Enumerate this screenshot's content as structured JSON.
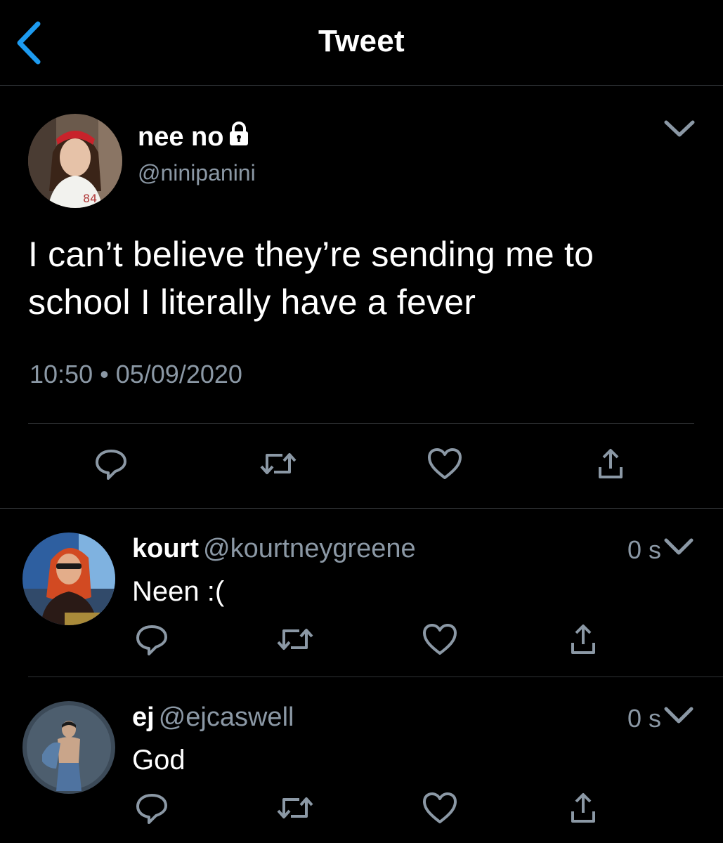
{
  "header": {
    "title": "Tweet",
    "back_icon": "chevron-left-icon",
    "accent": "#1d9bf0"
  },
  "tweet": {
    "display_name": "nee no",
    "handle": "@ninipanini",
    "protected_icon": "lock-icon",
    "text": "I can’t believe they’re sending me to school I literally have a fever",
    "time": "10:50",
    "separator": "•",
    "date": "05/09/2020"
  },
  "actions": [
    "reply-icon",
    "retweet-icon",
    "like-icon",
    "share-icon"
  ],
  "replies": [
    {
      "display_name": "kourt",
      "handle": "@kourtneygreene",
      "time": "0 s",
      "text": "Neen :("
    },
    {
      "display_name": "ej",
      "handle": "@ejcaswell",
      "time": "0 s",
      "text": "God"
    }
  ],
  "colors": {
    "background": "#000000",
    "secondary_text": "#8b98a5",
    "divider": "#2f3336"
  }
}
